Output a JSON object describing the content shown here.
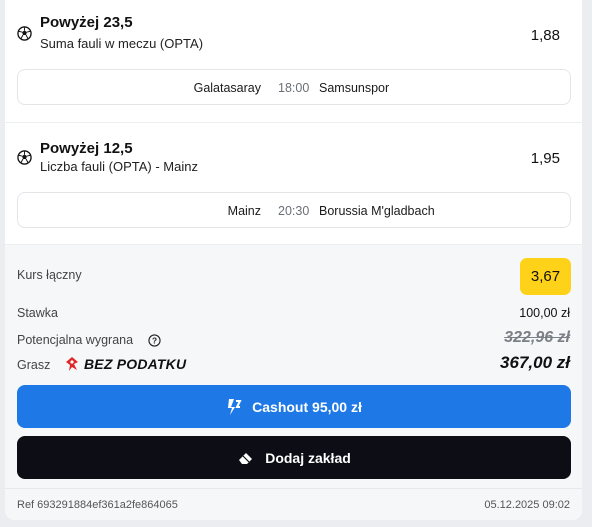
{
  "selections": [
    {
      "pick": "Powyżej 23,5",
      "market": "Suma fauli w meczu (OPTA)",
      "odds": "1,88",
      "home": "Galatasaray",
      "time": "18:00",
      "away": "Samsunspor"
    },
    {
      "pick": "Powyżej 12,5",
      "market": "Liczba fauli (OPTA) - Mainz",
      "odds": "1,95",
      "home": "Mainz",
      "time": "20:30",
      "away": "Borussia M'gladbach"
    }
  ],
  "summary": {
    "total_odds_label": "Kurs łączny",
    "total_odds": "3,67",
    "stake_label": "Stawka",
    "stake": "100,00 zł",
    "potential_win_label": "Potencjalna wygrana",
    "potential_win_old": "322,96 zł",
    "tax_free_prefix": "Grasz",
    "tax_free_text": "BEZ PODATKU",
    "potential_win_new": "367,00 zł"
  },
  "buttons": {
    "cashout": "Cashout 95,00 zł",
    "add_bet": "Dodaj zakład"
  },
  "footer": {
    "ref": "Ref 693291884ef361a2fe864065",
    "date": "05.12.2025 09:02"
  },
  "colors": {
    "accent_yellow": "#ffd21a",
    "cashout_blue": "#1e79e6",
    "add_bet_black": "#0c0d15",
    "tax_red": "#e0262a"
  },
  "icons": [
    "soccer-ball-icon",
    "info-icon",
    "tax-free-icon",
    "cashout-icon",
    "eraser-icon"
  ]
}
